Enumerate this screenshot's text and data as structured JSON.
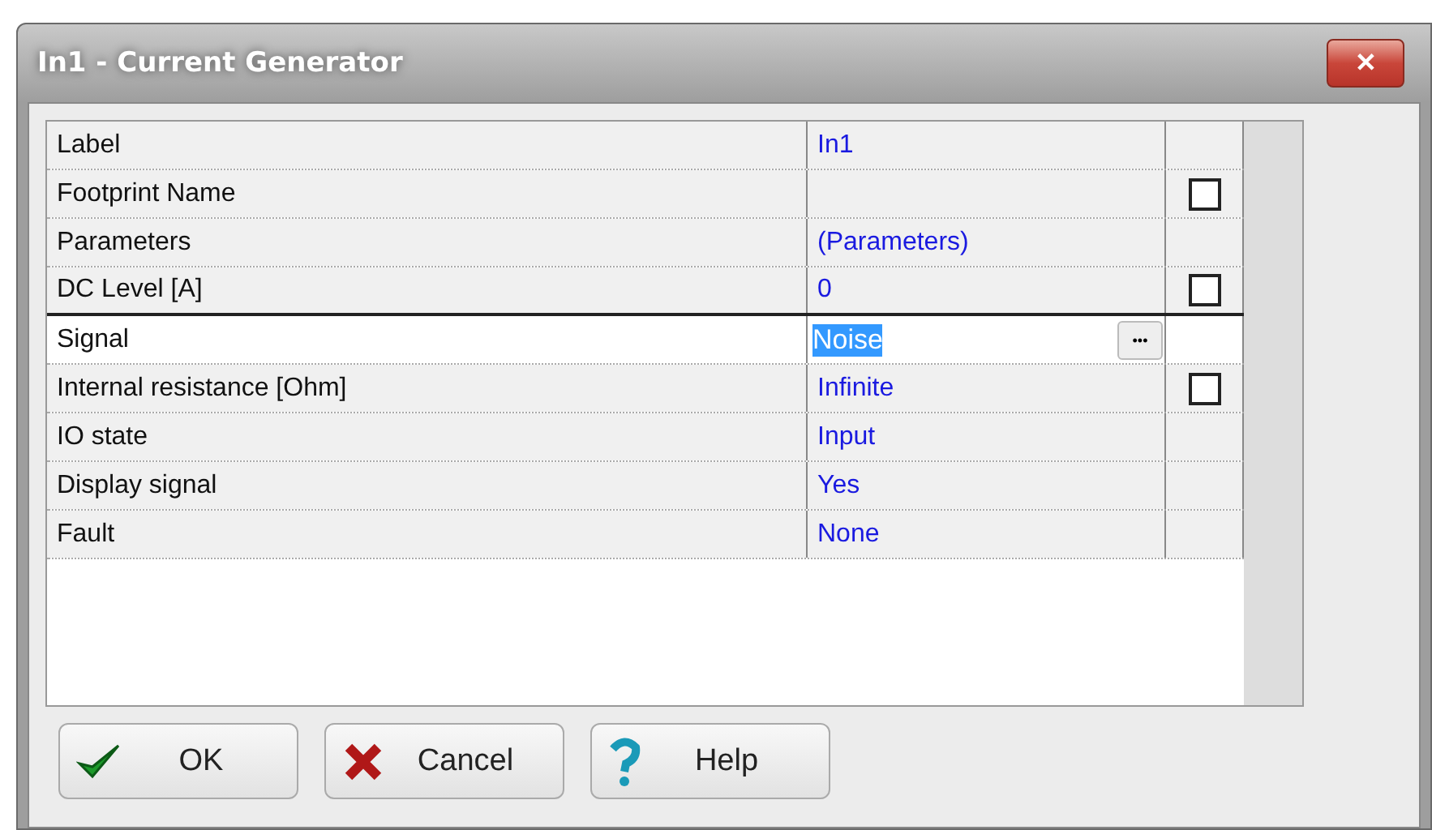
{
  "window": {
    "title": "In1 - Current Generator",
    "close": "✕"
  },
  "properties": [
    {
      "name": "Label",
      "value": "In1",
      "selected": false
    },
    {
      "name": "Footprint Name",
      "selected": false,
      "checkbox": {
        "checked": false
      }
    },
    {
      "name": "Parameters",
      "value": "(Parameters)",
      "selected": false
    },
    {
      "name": "DC Level [A]",
      "value": "0",
      "selected": false,
      "checkbox": {
        "checked": false
      }
    },
    {
      "name": "Signal",
      "value": "Noise",
      "selected": true,
      "button": "•••"
    },
    {
      "name": "Internal resistance [Ohm]",
      "value": "Infinite",
      "selected": false,
      "checkbox": {
        "checked": false
      }
    },
    {
      "name": "IO state",
      "value": "Input",
      "selected": false
    },
    {
      "name": "Display signal",
      "value": "Yes",
      "selected": false
    },
    {
      "name": "Fault",
      "value": "None",
      "selected": false
    }
  ],
  "buttons": [
    {
      "kind": "ok",
      "label": "OK"
    },
    {
      "kind": "cancel",
      "label": "Cancel"
    },
    {
      "kind": "help",
      "label": "Help"
    }
  ]
}
